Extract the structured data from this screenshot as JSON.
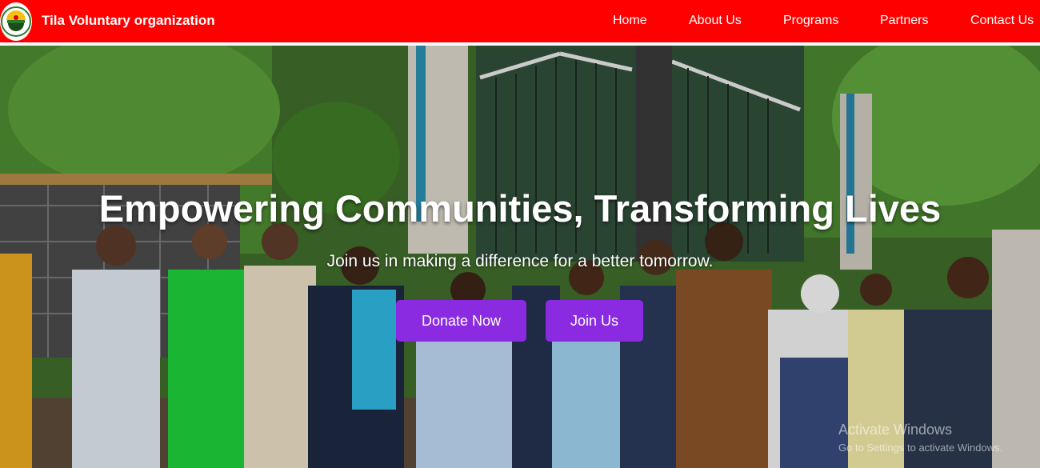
{
  "navbar": {
    "brand": "Tila Voluntary organization",
    "background_color": "#ff0000",
    "logo_icon": "tila-logo-icon",
    "links": [
      {
        "label": "Home"
      },
      {
        "label": "About Us"
      },
      {
        "label": "Programs"
      },
      {
        "label": "Partners"
      },
      {
        "label": "Contact Us"
      }
    ]
  },
  "hero": {
    "title": "Empowering Communities, Transforming Lives",
    "subtitle": "Join us in making a difference for a better tomorrow.",
    "background_image": "group-photo-outside-gate",
    "buttons": {
      "donate_label": "Donate Now",
      "join_label": "Join Us",
      "button_color": "#8a2be2"
    }
  },
  "watermark": {
    "title": "Activate Windows",
    "subtitle": "Go to Settings to activate Windows."
  }
}
